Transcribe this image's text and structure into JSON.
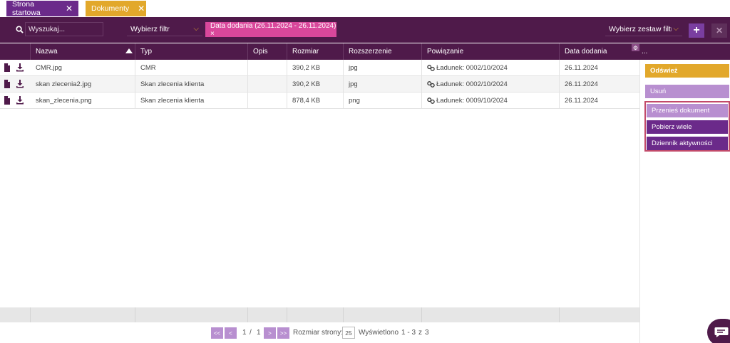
{
  "tabs": [
    {
      "label": "Strona startowa",
      "close": "✕"
    },
    {
      "label": "Dokumenty",
      "close": "✕"
    }
  ],
  "toolbar": {
    "search_placeholder": "Wyszukaj...",
    "filter_select": "Wybierz filtr",
    "active_filter": "Data dodania (26.11.2024 - 26.11.2024) ×",
    "filterset_select": "Wybierz zestaw filtrów",
    "add_label": "+",
    "remove_label": "✕"
  },
  "columns": [
    "Nazwa",
    "Typ",
    "Opis",
    "Rozmiar",
    "Rozszerzenie",
    "Powiązanie",
    "Data dodania"
  ],
  "more_label": "...",
  "rows": [
    {
      "name": "CMR.jpg",
      "type": "CMR",
      "desc": "",
      "size": "390,2 KB",
      "ext": "jpg",
      "link": "Ładunek: 0002/10/2024",
      "date": "26.11.2024"
    },
    {
      "name": "skan zlecenia2.jpg",
      "type": "Skan zlecenia klienta",
      "desc": "",
      "size": "390,2 KB",
      "ext": "jpg",
      "link": "Ładunek: 0002/10/2024",
      "date": "26.11.2024"
    },
    {
      "name": "skan_zlecenia.png",
      "type": "Skan zlecenia klienta",
      "desc": "",
      "size": "878,4 KB",
      "ext": "png",
      "link": "Ładunek: 0009/10/2024",
      "date": "26.11.2024"
    }
  ],
  "side": {
    "refresh": "Odśwież",
    "delete": "Usuń",
    "move": "Przenieś dokument",
    "download_many": "Pobierz wiele",
    "activity_log": "Dziennik aktywności"
  },
  "pager": {
    "first": "<<",
    "prev": "<",
    "page": "1",
    "sep": "/",
    "pages": "1",
    "next": ">",
    "last": ">>",
    "size_label": "Rozmiar strony:",
    "size": "25",
    "shown_label": "Wyświetlono",
    "range": "1 - 3",
    "of": "z",
    "total": "3"
  },
  "colors": {
    "primary": "#4f1a4a",
    "accent": "#e2a82b",
    "chip": "#d9479b",
    "light_purple": "#b88fd0",
    "purple": "#6b2a8a"
  }
}
